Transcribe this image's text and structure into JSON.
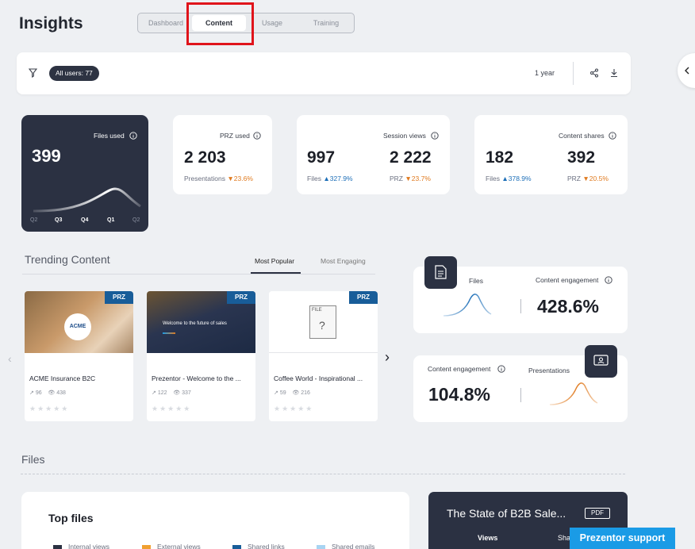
{
  "header": {
    "title": "Insights"
  },
  "tabs": [
    {
      "label": "Dashboard"
    },
    {
      "label": "Content"
    },
    {
      "label": "Usage"
    },
    {
      "label": "Training"
    }
  ],
  "filterbar": {
    "users_pill": "All users: 77",
    "period": "1 year"
  },
  "stats": {
    "files_used": {
      "label": "Files used",
      "value": "399",
      "axis": [
        "Q2",
        "Q3",
        "Q4",
        "Q1",
        "Q2"
      ]
    },
    "prz_used": {
      "label": "PRZ used",
      "value": "2 203",
      "sub_label": "Presentations",
      "change": "23.6%"
    },
    "session_views": {
      "label": "Session views",
      "files_value": "997",
      "prz_value": "2 222",
      "files_label": "Files",
      "files_change": "327.9%",
      "prz_label": "PRZ",
      "prz_change": "23.7%"
    },
    "content_shares": {
      "label": "Content shares",
      "files_value": "182",
      "prz_value": "392",
      "files_label": "Files",
      "files_change": "378.9%",
      "prz_label": "PRZ",
      "prz_change": "20.5%"
    }
  },
  "trending": {
    "title": "Trending Content",
    "tabs": [
      "Most Popular",
      "Most Engaging"
    ],
    "items": [
      {
        "badge": "PRZ",
        "title": "ACME Insurance B2C",
        "shares": "96",
        "views": "438",
        "logo_text": "ACME"
      },
      {
        "badge": "PRZ",
        "title": "Prezentor - Welcome to the ...",
        "shares": "122",
        "views": "337",
        "slide_text": "Welcome to the future of sales"
      },
      {
        "badge": "PRZ",
        "title": "Coffee World - Inspirational ...",
        "shares": "59",
        "views": "216",
        "file_ext": "FILE",
        "file_glyph": "?"
      }
    ]
  },
  "engagement": {
    "files": {
      "label": "Files",
      "metric_label": "Content engagement",
      "value": "428.6%"
    },
    "presentations": {
      "label": "Presentations",
      "metric_label": "Content engagement",
      "value": "104.8%"
    }
  },
  "files_section": {
    "title": "Files",
    "top_files": {
      "title": "Top files",
      "legend": [
        "Internal views",
        "External views",
        "Shared links",
        "Shared emails"
      ]
    },
    "featured": {
      "title": "The State of B2B Sale...",
      "badge": "PDF",
      "tab_views": "Views",
      "tab_shares": "Shares"
    }
  },
  "support": {
    "label": "Prezentor support"
  },
  "colors": {
    "dark": "#2b3142",
    "accent": "#185d99",
    "up": "#1d6fb8",
    "down": "#e07a1f",
    "support": "#1a9be6",
    "highlight": "#e0141b"
  }
}
